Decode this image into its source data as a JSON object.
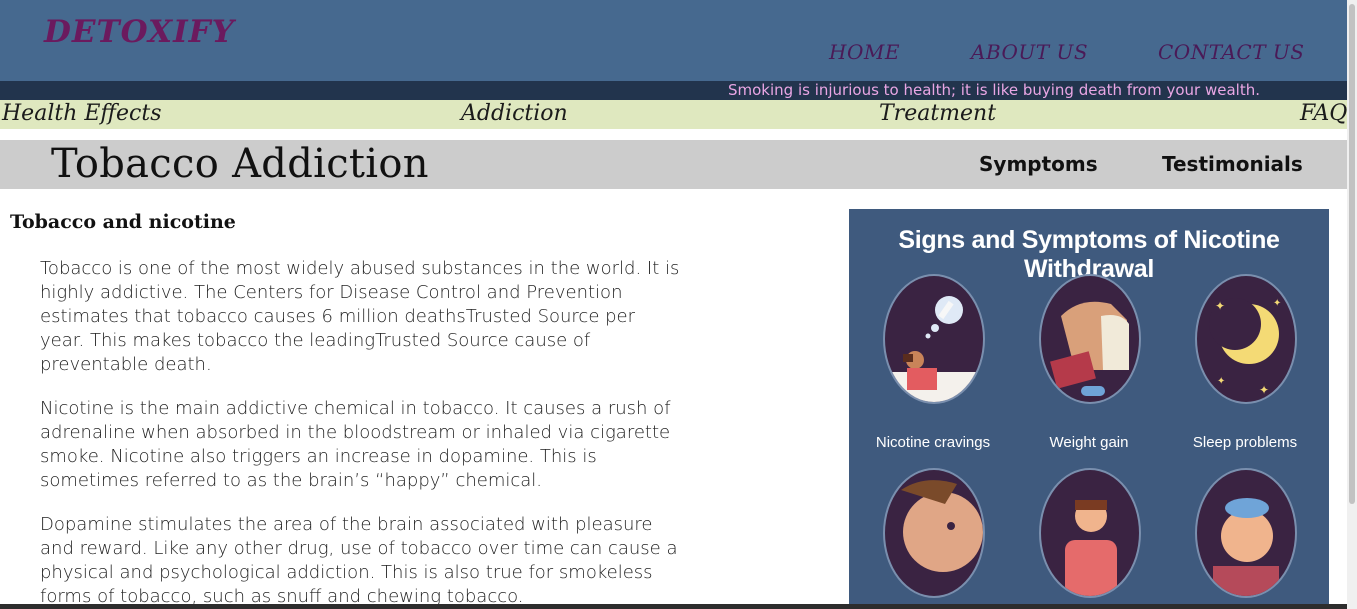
{
  "header": {
    "logo": "DETOXIFY",
    "nav": [
      "HOME",
      "ABOUT US",
      "CONTACT US"
    ]
  },
  "marquee": "Smoking is injurious to health; it is like buying death from your wealth.",
  "subnav": [
    "Health Effects",
    "Addiction",
    "Treatment",
    "FAQ"
  ],
  "title_bar": {
    "title": "Tobacco Addiction",
    "links": [
      "Symptoms",
      "Testimonials"
    ]
  },
  "content": {
    "heading": "Tobacco and nicotine",
    "paragraphs": [
      "Tobacco is one of the most widely abused substances in the world. It is highly addictive. The Centers for Disease Control and Prevention estimates that tobacco causes 6 million deathsTrusted Source per year. This makes tobacco the leadingTrusted Source cause of preventable death.",
      "Nicotine is the main addictive chemical in tobacco. It causes a rush of adrenaline when absorbed in the bloodstream or inhaled via cigarette smoke. Nicotine also triggers an increase in dopamine. This is sometimes referred to as the brain’s “happy” chemical.",
      "Dopamine stimulates the area of the brain associated with pleasure and reward. Like any other drug, use of tobacco over time can cause a physical and psychological addiction. This is also true for smokeless forms of tobacco, such as snuff and chewing tobacco."
    ]
  },
  "infographic": {
    "title": "Signs and Symptoms of Nicotine Withdrawal",
    "captions": [
      "Nicotine cravings",
      "Weight gain",
      "Sleep problems"
    ]
  },
  "colors": {
    "header_bg": "#46698f",
    "logo": "#6b1a5e",
    "marquee_text": "#e9a6e4",
    "subnav_bg": "#dfe8bf",
    "title_bar_bg": "#cccccc",
    "infographic_bg": "#3f5a7e"
  }
}
